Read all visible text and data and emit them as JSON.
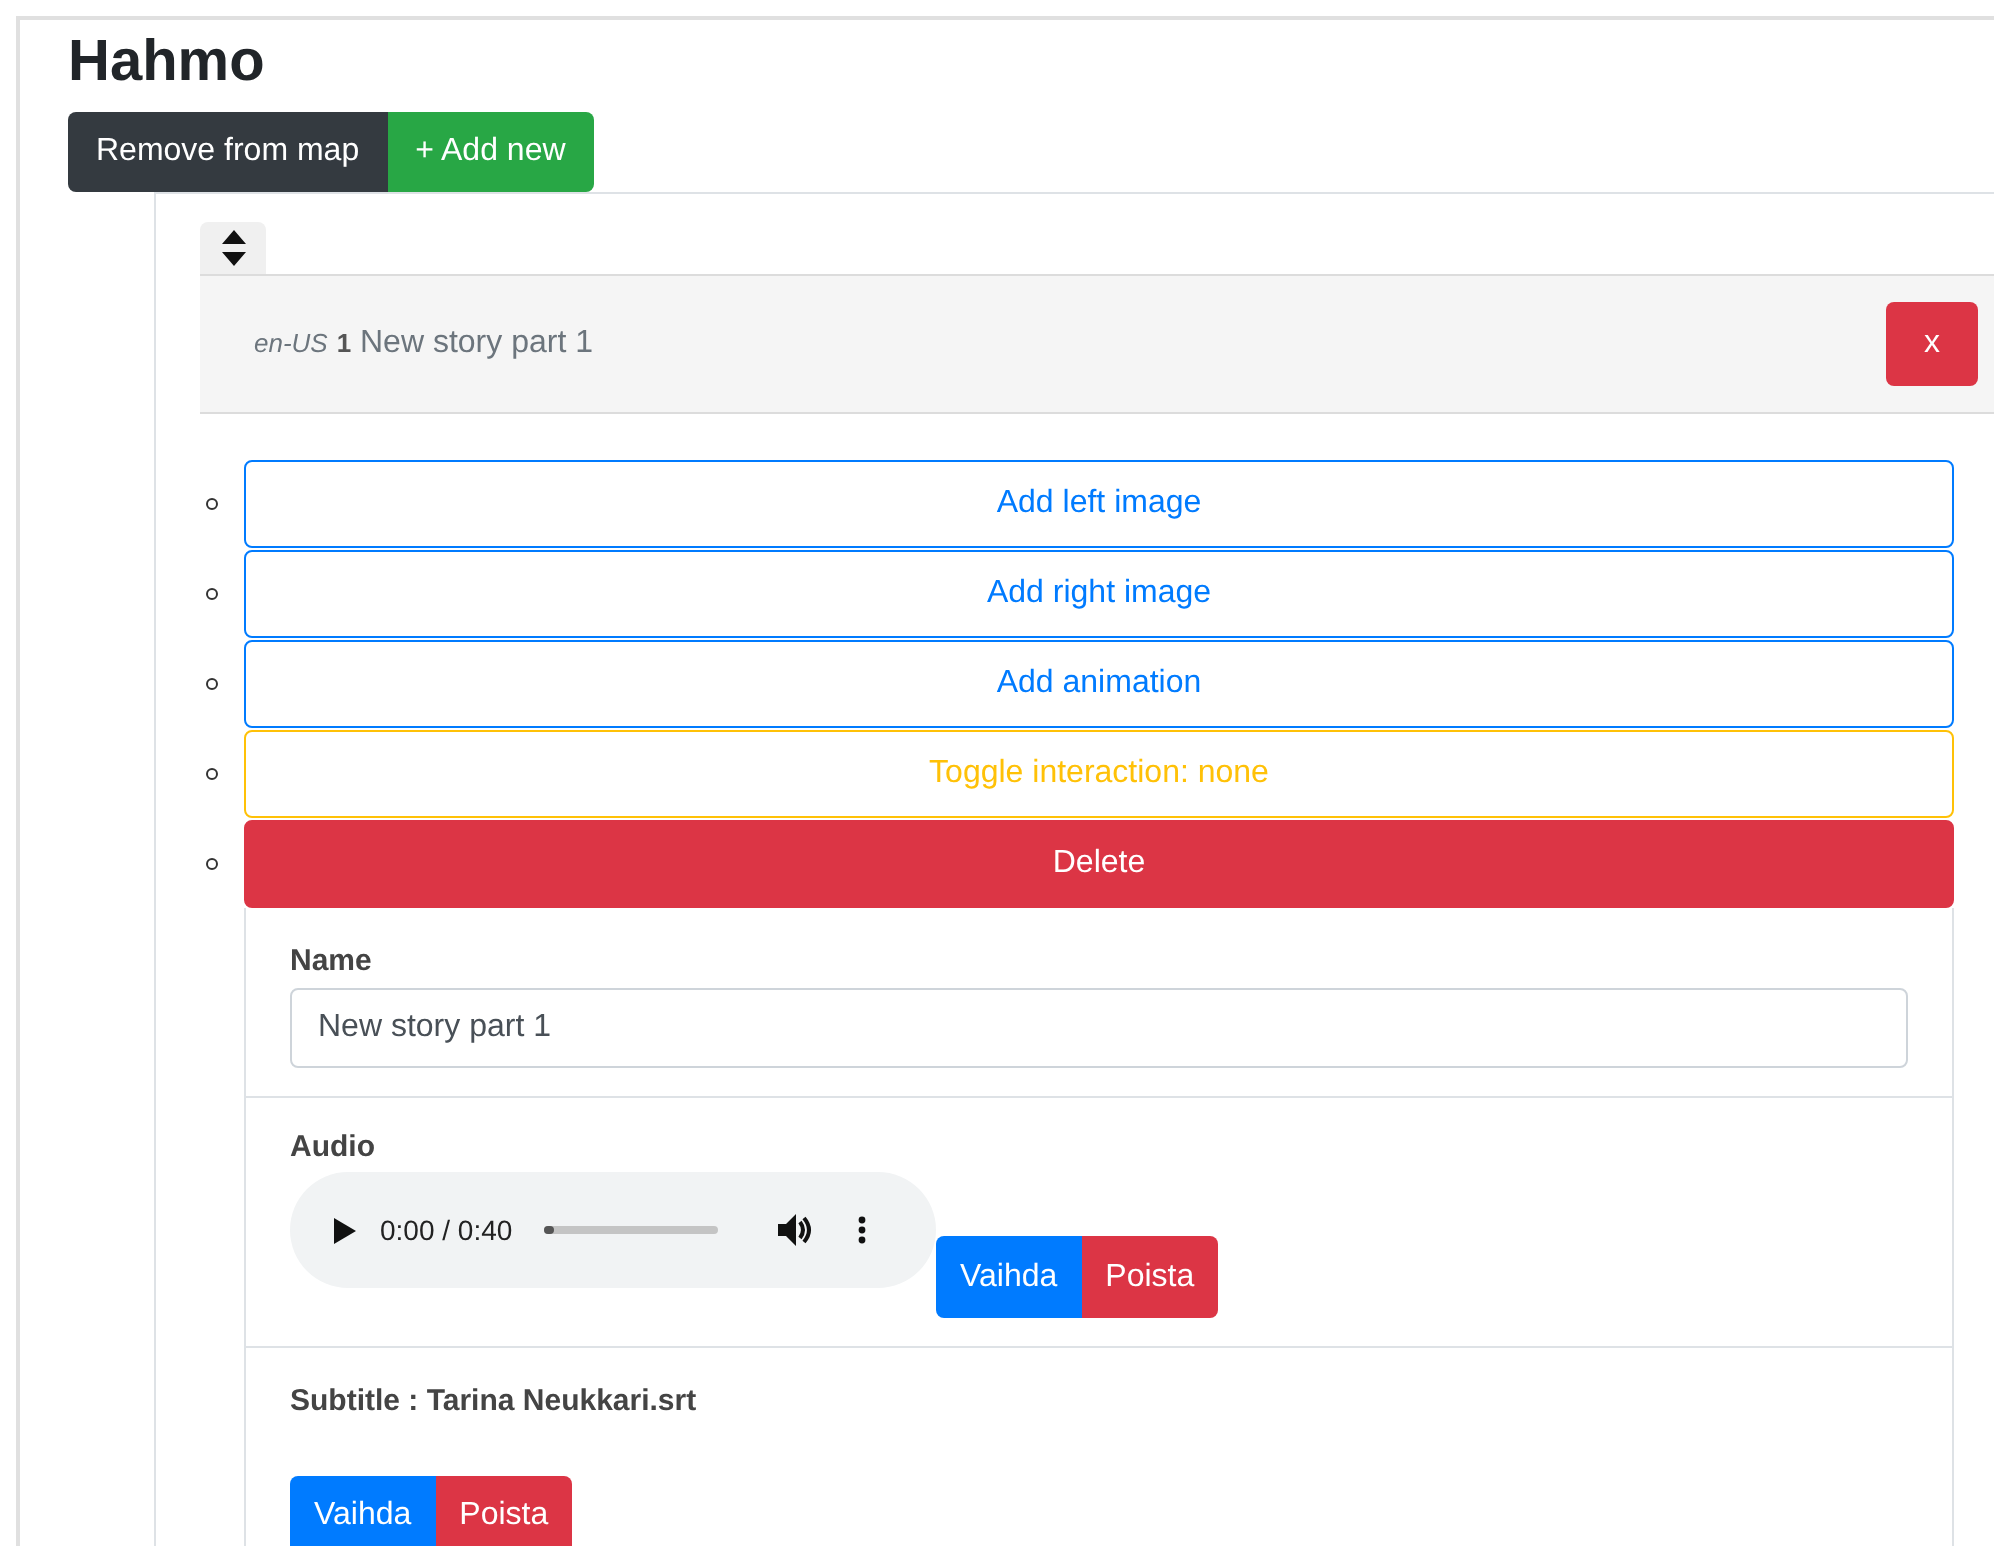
{
  "title": "Hahmo",
  "top_buttons": [
    {
      "label": "Remove from map",
      "kind": "dark"
    },
    {
      "label": "+ Add new",
      "kind": "success"
    }
  ],
  "card": {
    "locale": "en-US",
    "number": "1",
    "title": "New story part 1",
    "close_label": "x",
    "actions": [
      {
        "label": "Add left image",
        "kind": "primary"
      },
      {
        "label": "Add right image",
        "kind": "primary"
      },
      {
        "label": "Add animation",
        "kind": "primary"
      },
      {
        "label": "Toggle interaction: none",
        "kind": "warning"
      },
      {
        "label": "Delete",
        "kind": "danger"
      }
    ],
    "name_field": {
      "label": "Name",
      "value": "New story part 1"
    },
    "audio": {
      "label": "Audio",
      "time": "0:00 / 0:40",
      "level": 0.02,
      "buttons": [
        "Vaihda",
        "Poista"
      ]
    },
    "subtitle": {
      "label": "Subtitle : Tarina Neukkari.srt",
      "buttons": [
        "Vaihda",
        "Poista"
      ]
    }
  }
}
